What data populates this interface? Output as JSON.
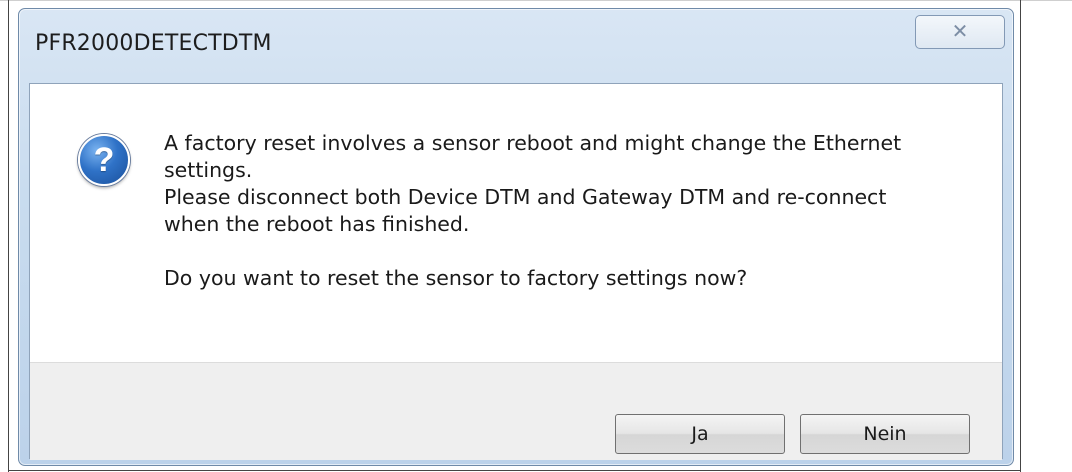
{
  "window": {
    "title": "PFR2000DETECTDTM",
    "close_icon": "close-icon"
  },
  "dialog": {
    "icon": "question-icon",
    "icon_glyph": "?",
    "message_lines": [
      "A factory reset involves a sensor reboot and might change the Ethernet",
      "settings.",
      "Please disconnect both Device DTM and Gateway DTM and re-connect",
      "when the reboot has finished."
    ],
    "question": "Do you want to reset the sensor to factory settings now?"
  },
  "buttons": {
    "yes_label": "Ja",
    "no_label": "Nein"
  }
}
